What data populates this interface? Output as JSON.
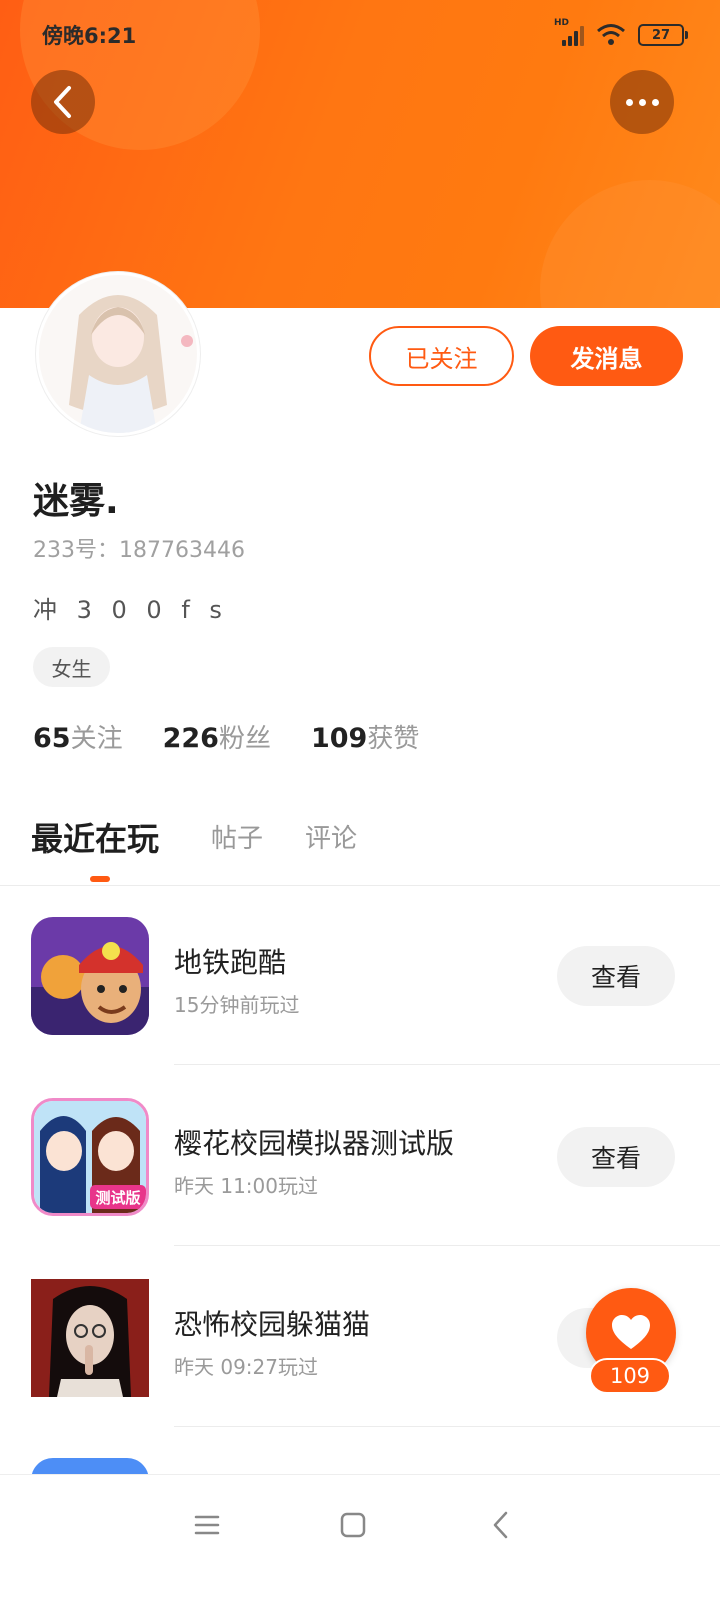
{
  "status_bar": {
    "time": "傍晚6:21",
    "battery": "27",
    "network_badge": "HD"
  },
  "header": {
    "back_icon": "chevron-left-icon",
    "more_icon": "more-dots-icon"
  },
  "profile": {
    "follow_label": "已关注",
    "message_label": "发消息",
    "username": "迷雾.",
    "user_id": "233号：187763446",
    "bio": "冲 3 0 0 f s",
    "gender_tag": "女生",
    "stats": [
      {
        "num": "65",
        "label": "关注"
      },
      {
        "num": "226",
        "label": "粉丝"
      },
      {
        "num": "109",
        "label": "获赞"
      }
    ]
  },
  "tabs": [
    {
      "label": "最近在玩",
      "active": true
    },
    {
      "label": "帖子",
      "active": false
    },
    {
      "label": "评论",
      "active": false
    }
  ],
  "games": [
    {
      "name": "地铁跑酷",
      "time": "15分钟前玩过",
      "button": "查看"
    },
    {
      "name": "樱花校园模拟器测试版",
      "time": "昨天 11:00玩过",
      "button": "查看"
    },
    {
      "name": "恐怖校园躲猫猫",
      "time": "昨天 09:27玩过",
      "button": "查看"
    }
  ],
  "game_icon_texts": {
    "sakura_badge": "测试版"
  },
  "like_fab": {
    "count": "109",
    "icon": "heart-icon"
  },
  "colors": {
    "accent": "#ff5a12",
    "header_start": "#ff5e14",
    "header_end": "#ff8a1c"
  },
  "nav": {
    "menu_icon": "menu-icon",
    "home_icon": "home-square-icon",
    "back_icon": "back-triangle-icon"
  }
}
